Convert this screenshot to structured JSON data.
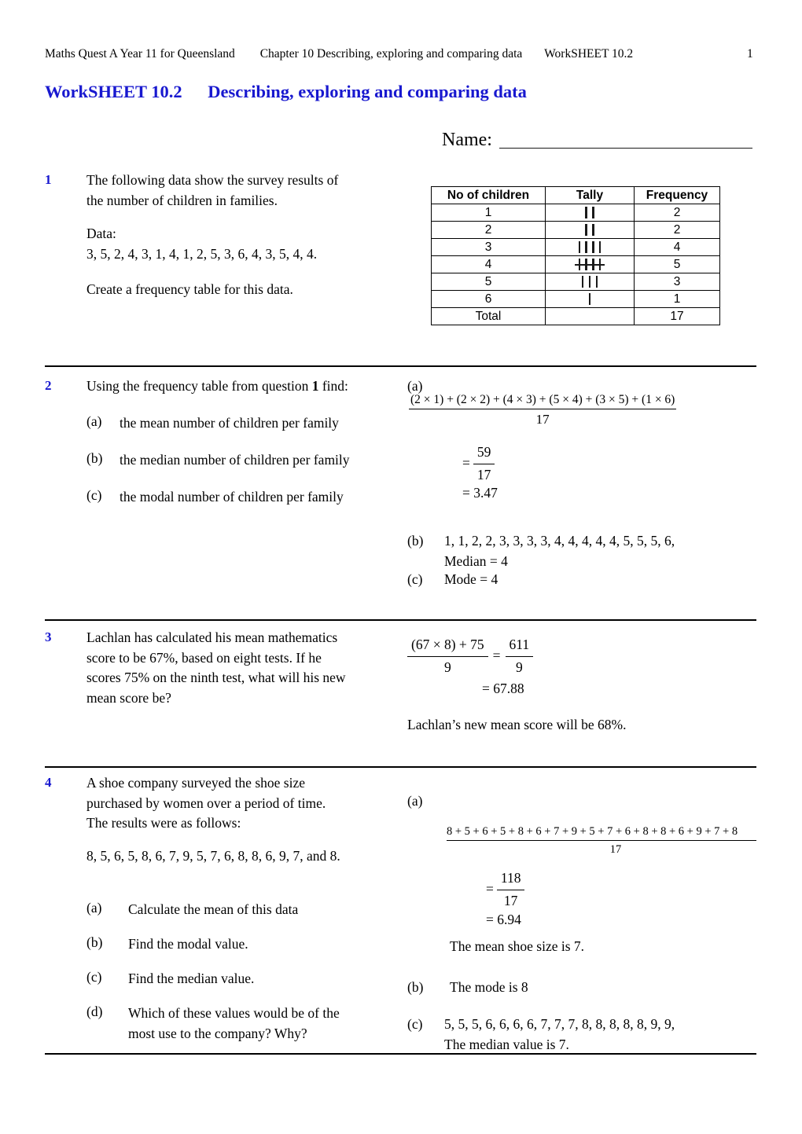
{
  "header": {
    "book": "Maths Quest A Year 11 for Queensland",
    "chapter": "Chapter 10 Describing, exploring and comparing data",
    "worksheet": "WorkSHEET 10.2",
    "page": "1"
  },
  "title": {
    "number": "WorkSHEET 10.2",
    "subject": "Describing, exploring and comparing data"
  },
  "name_field": {
    "label": "Name:",
    "value": ""
  },
  "questions": [
    {
      "number": "1",
      "text_line1": "The following data show the survey results of",
      "text_line2": "the number of children in families.",
      "data_label": "Data:",
      "data_values": "3, 5, 2, 4, 3, 1, 4, 1, 2, 5, 3, 6, 4, 3, 5, 4, 4.",
      "instruction": "Create a frequency table for this data."
    },
    {
      "number": "2",
      "stem": "Using the frequency table from question 1 find:",
      "stem_pre": "Using the frequency table from question",
      "stem_ref": "1",
      "stem_post": "find:",
      "parts": [
        {
          "marker": "(a)",
          "text": "the mean number of children per family"
        },
        {
          "marker": "(b)",
          "text": "the median number of children per family"
        },
        {
          "marker": "(c)",
          "text": "the modal number of children per family"
        }
      ],
      "answers": {
        "a_marker": "(a)",
        "a_numerator": "(2 × 1) + (2 × 2) + (4 × 3) + (5 × 4) + (3 × 5) + (1 × 6)",
        "a_denominator": "17",
        "a_eq1_sign": "=",
        "a_eq1_num": "59",
        "a_eq1_den": "17",
        "a_eq2": "= 3.47",
        "b_marker": "(b)",
        "b_list": "1, 1, 2, 2, 3, 3, 3, 3, 4, 4, 4, 4, 4, 5, 5, 5, 6,",
        "b_result": "Median = 4",
        "c_marker": "(c)",
        "c_result": "Mode = 4"
      }
    },
    {
      "number": "3",
      "text_line1": "Lachlan has calculated his mean mathematics",
      "text_line2": "score to be 67%, based on eight tests. If he",
      "text_line3": "scores 75% on the ninth test, what will his new",
      "text_line4": "mean score be?",
      "answers": {
        "f1_num": "(67 × 8) + 75",
        "f1_den": "9",
        "eq_sign": "=",
        "f2_num": "611",
        "f2_den": "9",
        "eq2": "= 67.88",
        "conclusion": "Lachlan’s new mean score will be 68%."
      }
    },
    {
      "number": "4",
      "text_line1": "A shoe company surveyed the shoe size",
      "text_line2": "purchased by women over a period of time.",
      "text_line3": "The results were as follows:",
      "data_values": "8, 5, 6, 5, 8, 6, 7, 9, 5, 7, 6, 8, 8, 6, 9, 7, and 8.",
      "parts": [
        {
          "marker": "(a)",
          "text": "Calculate the mean of this data"
        },
        {
          "marker": "(b)",
          "text": "Find the modal value."
        },
        {
          "marker": "(c)",
          "text": "Find the median value."
        },
        {
          "marker": "(d)",
          "text_line1": "Which of these values would be of the",
          "text_line2": "most use to the company? Why?"
        }
      ],
      "answers": {
        "a_marker": "(a)",
        "a_numerator": "8 + 5 + 6 + 5 + 8 + 6 + 7 + 9 + 5 + 7 + 6 + 8 + 8 + 6 + 9 + 7 + 8",
        "a_denominator": "17",
        "a_eq1_sign": "=",
        "a_eq1_num": "118",
        "a_eq1_den": "17",
        "a_eq2": "= 6.94",
        "a_conclusion": "The mean shoe size is 7.",
        "b_marker": "(b)",
        "b_result": "The mode is 8",
        "c_marker": "(c)",
        "c_list": "5, 5, 5, 6, 6, 6, 6, 7, 7, 7, 8, 8, 8, 8, 8, 9, 9,",
        "c_result": "The median value is 7."
      }
    }
  ],
  "frequency_table": {
    "headers": [
      "No of children",
      "Tally",
      "Frequency"
    ],
    "rows": [
      {
        "children": "1",
        "tally_count": 2,
        "tally_bundle": false,
        "frequency": "2"
      },
      {
        "children": "2",
        "tally_count": 2,
        "tally_bundle": false,
        "frequency": "2"
      },
      {
        "children": "3",
        "tally_count": 4,
        "tally_bundle": false,
        "frequency": "4"
      },
      {
        "children": "4",
        "tally_count": 4,
        "tally_bundle": true,
        "frequency": "5"
      },
      {
        "children": "5",
        "tally_count": 3,
        "tally_bundle": false,
        "frequency": "3"
      },
      {
        "children": "6",
        "tally_count": 1,
        "tally_bundle": false,
        "frequency": "1"
      }
    ],
    "total_label": "Total",
    "total_tally": "",
    "total_frequency": "17"
  },
  "colors": {
    "heading_blue": "#1818cf",
    "text_black": "#000000",
    "rule_black": "#000000"
  }
}
